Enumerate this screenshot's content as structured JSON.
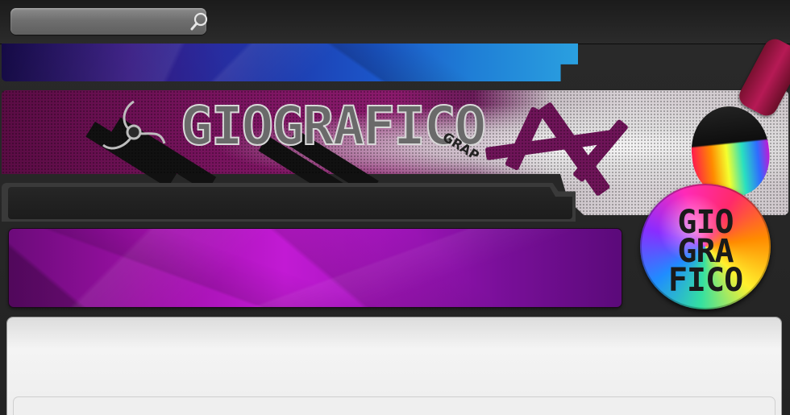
{
  "header": {
    "search": {
      "placeholder": "",
      "value": ""
    },
    "search_icon": "search-icon"
  },
  "banner": {
    "logo_text": "GIOGRAFICO",
    "tagline": "GRAP",
    "badge_text": "GIO\nGRA\nFICO"
  },
  "colors": {
    "background": "#262626",
    "banner_magenta": "#7a1460",
    "purple_banner": "#c21ad4",
    "blue_strip": "#1f35a8",
    "content_panel": "#f0f0f0"
  }
}
